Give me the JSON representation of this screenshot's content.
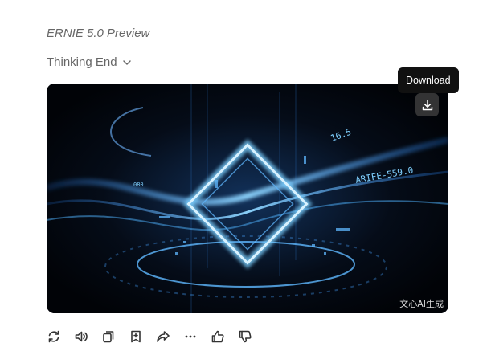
{
  "message": {
    "model_name": "ERNIE 5.0 Preview",
    "thinking_label": "Thinking End"
  },
  "image": {
    "overlay_texts": [
      "16.5",
      "ARIFE-559.0",
      "080"
    ],
    "watermark": "文心AI生成",
    "download_tooltip": "Download"
  },
  "actions": [
    {
      "name": "regenerate-icon"
    },
    {
      "name": "speaker-icon"
    },
    {
      "name": "copy-icon"
    },
    {
      "name": "bookmark-add-icon"
    },
    {
      "name": "share-icon"
    },
    {
      "name": "more-icon"
    },
    {
      "name": "thumbs-up-icon"
    },
    {
      "name": "thumbs-down-icon"
    }
  ],
  "colors": {
    "text_muted": "#666666",
    "tooltip_bg": "#111111",
    "image_bg": "#02060e",
    "glow": "#4fb3ff"
  }
}
